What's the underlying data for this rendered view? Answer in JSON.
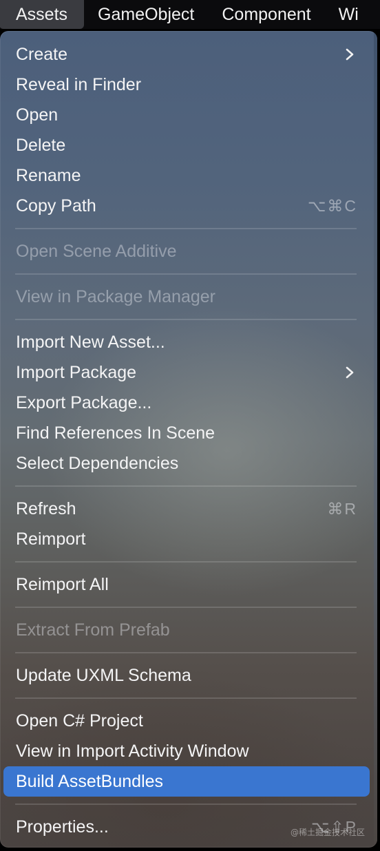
{
  "menubar": {
    "items": [
      "Assets",
      "GameObject",
      "Component",
      "Wi"
    ]
  },
  "menu": {
    "groups": [
      {
        "items": [
          {
            "label": "Create",
            "submenu": true
          },
          {
            "label": "Reveal in Finder"
          },
          {
            "label": "Open"
          },
          {
            "label": "Delete"
          },
          {
            "label": "Rename"
          },
          {
            "label": "Copy Path",
            "shortcut": "⌥⌘C"
          }
        ]
      },
      {
        "items": [
          {
            "label": "Open Scene Additive",
            "disabled": true
          }
        ]
      },
      {
        "items": [
          {
            "label": "View in Package Manager",
            "disabled": true
          }
        ]
      },
      {
        "items": [
          {
            "label": "Import New Asset..."
          },
          {
            "label": "Import Package",
            "submenu": true
          },
          {
            "label": "Export Package..."
          },
          {
            "label": "Find References In Scene"
          },
          {
            "label": "Select Dependencies"
          }
        ]
      },
      {
        "items": [
          {
            "label": "Refresh",
            "shortcut": "⌘R"
          },
          {
            "label": "Reimport"
          }
        ]
      },
      {
        "items": [
          {
            "label": "Reimport All"
          }
        ]
      },
      {
        "items": [
          {
            "label": "Extract From Prefab",
            "disabled": true
          }
        ]
      },
      {
        "items": [
          {
            "label": "Update UXML Schema"
          }
        ]
      },
      {
        "items": [
          {
            "label": "Open C# Project"
          },
          {
            "label": "View in Import Activity Window"
          },
          {
            "label": "Build AssetBundles",
            "highlighted": true
          }
        ]
      },
      {
        "items": [
          {
            "label": "Properties...",
            "shortcut": "⌥⇧P"
          }
        ]
      }
    ]
  },
  "watermark": "@稀土掘金技术社区",
  "colors": {
    "highlight": "#3a76d0",
    "menubar": "#0b0b0d",
    "menubar_active": "#3a3b40"
  }
}
